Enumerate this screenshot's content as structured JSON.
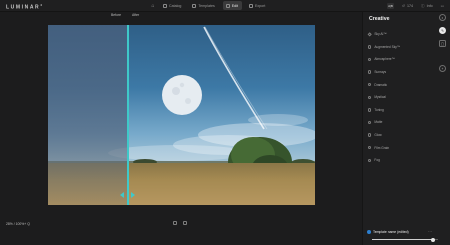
{
  "app": {
    "logo": "LUMINAR",
    "logo_mark": "4"
  },
  "top_tabs": [
    {
      "label": "",
      "icon": "home-icon"
    },
    {
      "label": "Catalog",
      "icon": "catalog-icon"
    },
    {
      "label": "Templates",
      "icon": "templates-icon"
    },
    {
      "label": "Edit",
      "icon": "edit-icon",
      "active": true
    },
    {
      "label": "Export",
      "icon": "export-icon"
    }
  ],
  "top_right": {
    "compare_label": "A|B",
    "edits_count": "174",
    "info_label": "Info"
  },
  "compare": {
    "before_label": "Before",
    "after_label": "After"
  },
  "status": {
    "zoom": "28% / 100%+ Q"
  },
  "panel": {
    "title": "Creative",
    "items": [
      "Sky AI™",
      "Augmented Sky™",
      "Atmosphere™",
      "Sunrays",
      "Dramatic",
      "Mystical",
      "Toning",
      "Matte",
      "Glow",
      "Film Grain",
      "Fog"
    ]
  },
  "template": {
    "label": "Template name (edited)",
    "amount": 0.92
  },
  "colors": {
    "accent": "#3fc9c9",
    "panel_bg": "#1f1f20",
    "app_bg": "#1c1c1d"
  }
}
